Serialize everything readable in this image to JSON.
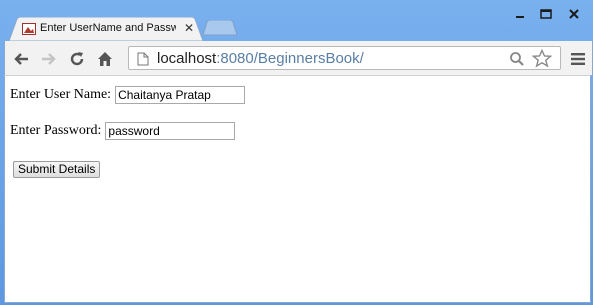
{
  "browser": {
    "tab_title": "Enter UserName and Password",
    "url_host": "localhost",
    "url_rest": ":8080/BeginnersBook/",
    "icons": {
      "back": "back-arrow-icon",
      "forward": "forward-arrow-icon",
      "reload": "reload-icon",
      "home": "home-icon",
      "page": "page-icon",
      "zoom": "search-zoom-icon",
      "bookmark": "star-icon",
      "menu": "hamburger-menu-icon"
    }
  },
  "form": {
    "username_label": "Enter User Name:",
    "username_value": "Chaitanya Pratap",
    "password_label": "Enter Password:",
    "password_value": "password",
    "submit_label": "Submit Details"
  }
}
